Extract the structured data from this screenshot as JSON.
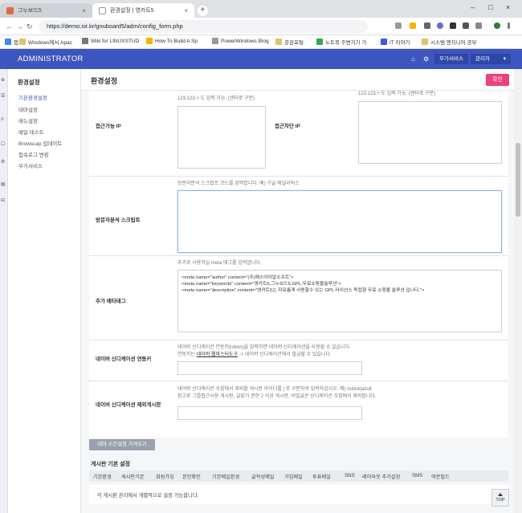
{
  "browser": {
    "tabs": [
      {
        "title": "그누보드5",
        "close": "×"
      },
      {
        "title": "환경설정 | 영카트5",
        "close": "×"
      }
    ],
    "new_tab": "+",
    "window_controls": [
      "–",
      "□",
      "×"
    ],
    "nav": {
      "back": "←",
      "forward": "→",
      "reload": "↻"
    },
    "url": "https://demo.sir.kr/gnuboard5/adm/config_form.php",
    "bookmarks": [
      "앱",
      "Windows에서 Apac",
      "Wiki for LINUXSTUD",
      "How To Build A Sp",
      "PowerWindows Blog",
      "공감포털",
      "노트북 주변기기 가",
      "IT 이야기",
      "시스템 엔지니어 공부"
    ]
  },
  "header": {
    "title": "ADMINISTRATOR",
    "home_icon": "⌂",
    "settings_icon": "⚙",
    "addon_button": "부가서비스",
    "admin_button": "관리자",
    "caret": "▾"
  },
  "rail_icons": [
    "⊕",
    "☰",
    "≡",
    "☐",
    "⚙",
    "▤",
    "⊟"
  ],
  "sidebar": {
    "heading": "환경설정",
    "items": [
      "기본환경설정",
      "테마설정",
      "메뉴설정",
      "메일 테스트",
      "Browscap 업데이트",
      "접속로그 변환",
      "부가서비스"
    ]
  },
  "page": {
    "title": "환경설정",
    "ok_button": "확인",
    "top_hint_left": "123.123.+ 도 입력 가능. (엔터로 구분)",
    "top_hint_right": "123.123.+ 도 입력 가능. (엔터로 구분)",
    "cut_left": "대",
    "access_ip_label": "접근가능 IP",
    "block_ip_label": "접근차단 IP",
    "analytics_label": "방문자분석 스크립트",
    "analytics_help": "방문자분석 스크립트 코드를 입력합니다. 예) 구글 애널리틱스",
    "meta_label": "추가 메타태그",
    "meta_help": "추가로 사용하실 meta 태그를 입력합니다.",
    "meta_value": "<meta name=\"author\" content=\"(주)에스아이알소프트\">\n<meta name=\"keywords\" content=\"영카트5,그누보드5,GPL,무료쇼핑몰솔루션\">\n<meta name=\"description\" content=\"영카트5는 자유롭게 사용할수 있는 GPL 라이선스 독립형 무료 쇼핑몰 솔루션 입니다.\">",
    "naver_token_label": "네이버 신디케이션 연동키",
    "naver_token_help1": "네이버 신디케이션 연동키(token)을 입력하면 네이버 신디케이션을 사용할 수 있습니다.",
    "naver_token_help2_pre": "연동키는 ",
    "naver_token_help2_link": "네이버 웹마스터도구",
    "naver_token_help2_post": " -> 네이버 신디케이션에서 발급할 수 있습니다.",
    "naver_except_label": "네이버 신디케이션 제외게시판",
    "naver_except_help1": "네이버 신디케이션 수집에서 제외할 게시판 아이디를 | 로 구분하여 입력하십시오. 예) notice|adult",
    "naver_except_help2": "참고로 그룹접근사용 게시판, 글읽기 권한 2 이상 게시판, 비밀글은 신디케이션 수집에서 제외됩니다.",
    "default_button": "테마 스킨설정 가져오기",
    "board_section": "게시판 기본 설정",
    "board_tabs": [
      "기본환경",
      "게시판기본",
      "회원가입",
      "본인확인",
      "기본메일환경",
      "글작성메일",
      "가입메일",
      "투표메일",
      "SNS",
      "레이아웃 추가설정",
      "SMS",
      "여분필드"
    ],
    "board_note": "각 게시판 관리에서 개별적으로 설정 가능합니다.",
    "top_button": "TOP"
  }
}
